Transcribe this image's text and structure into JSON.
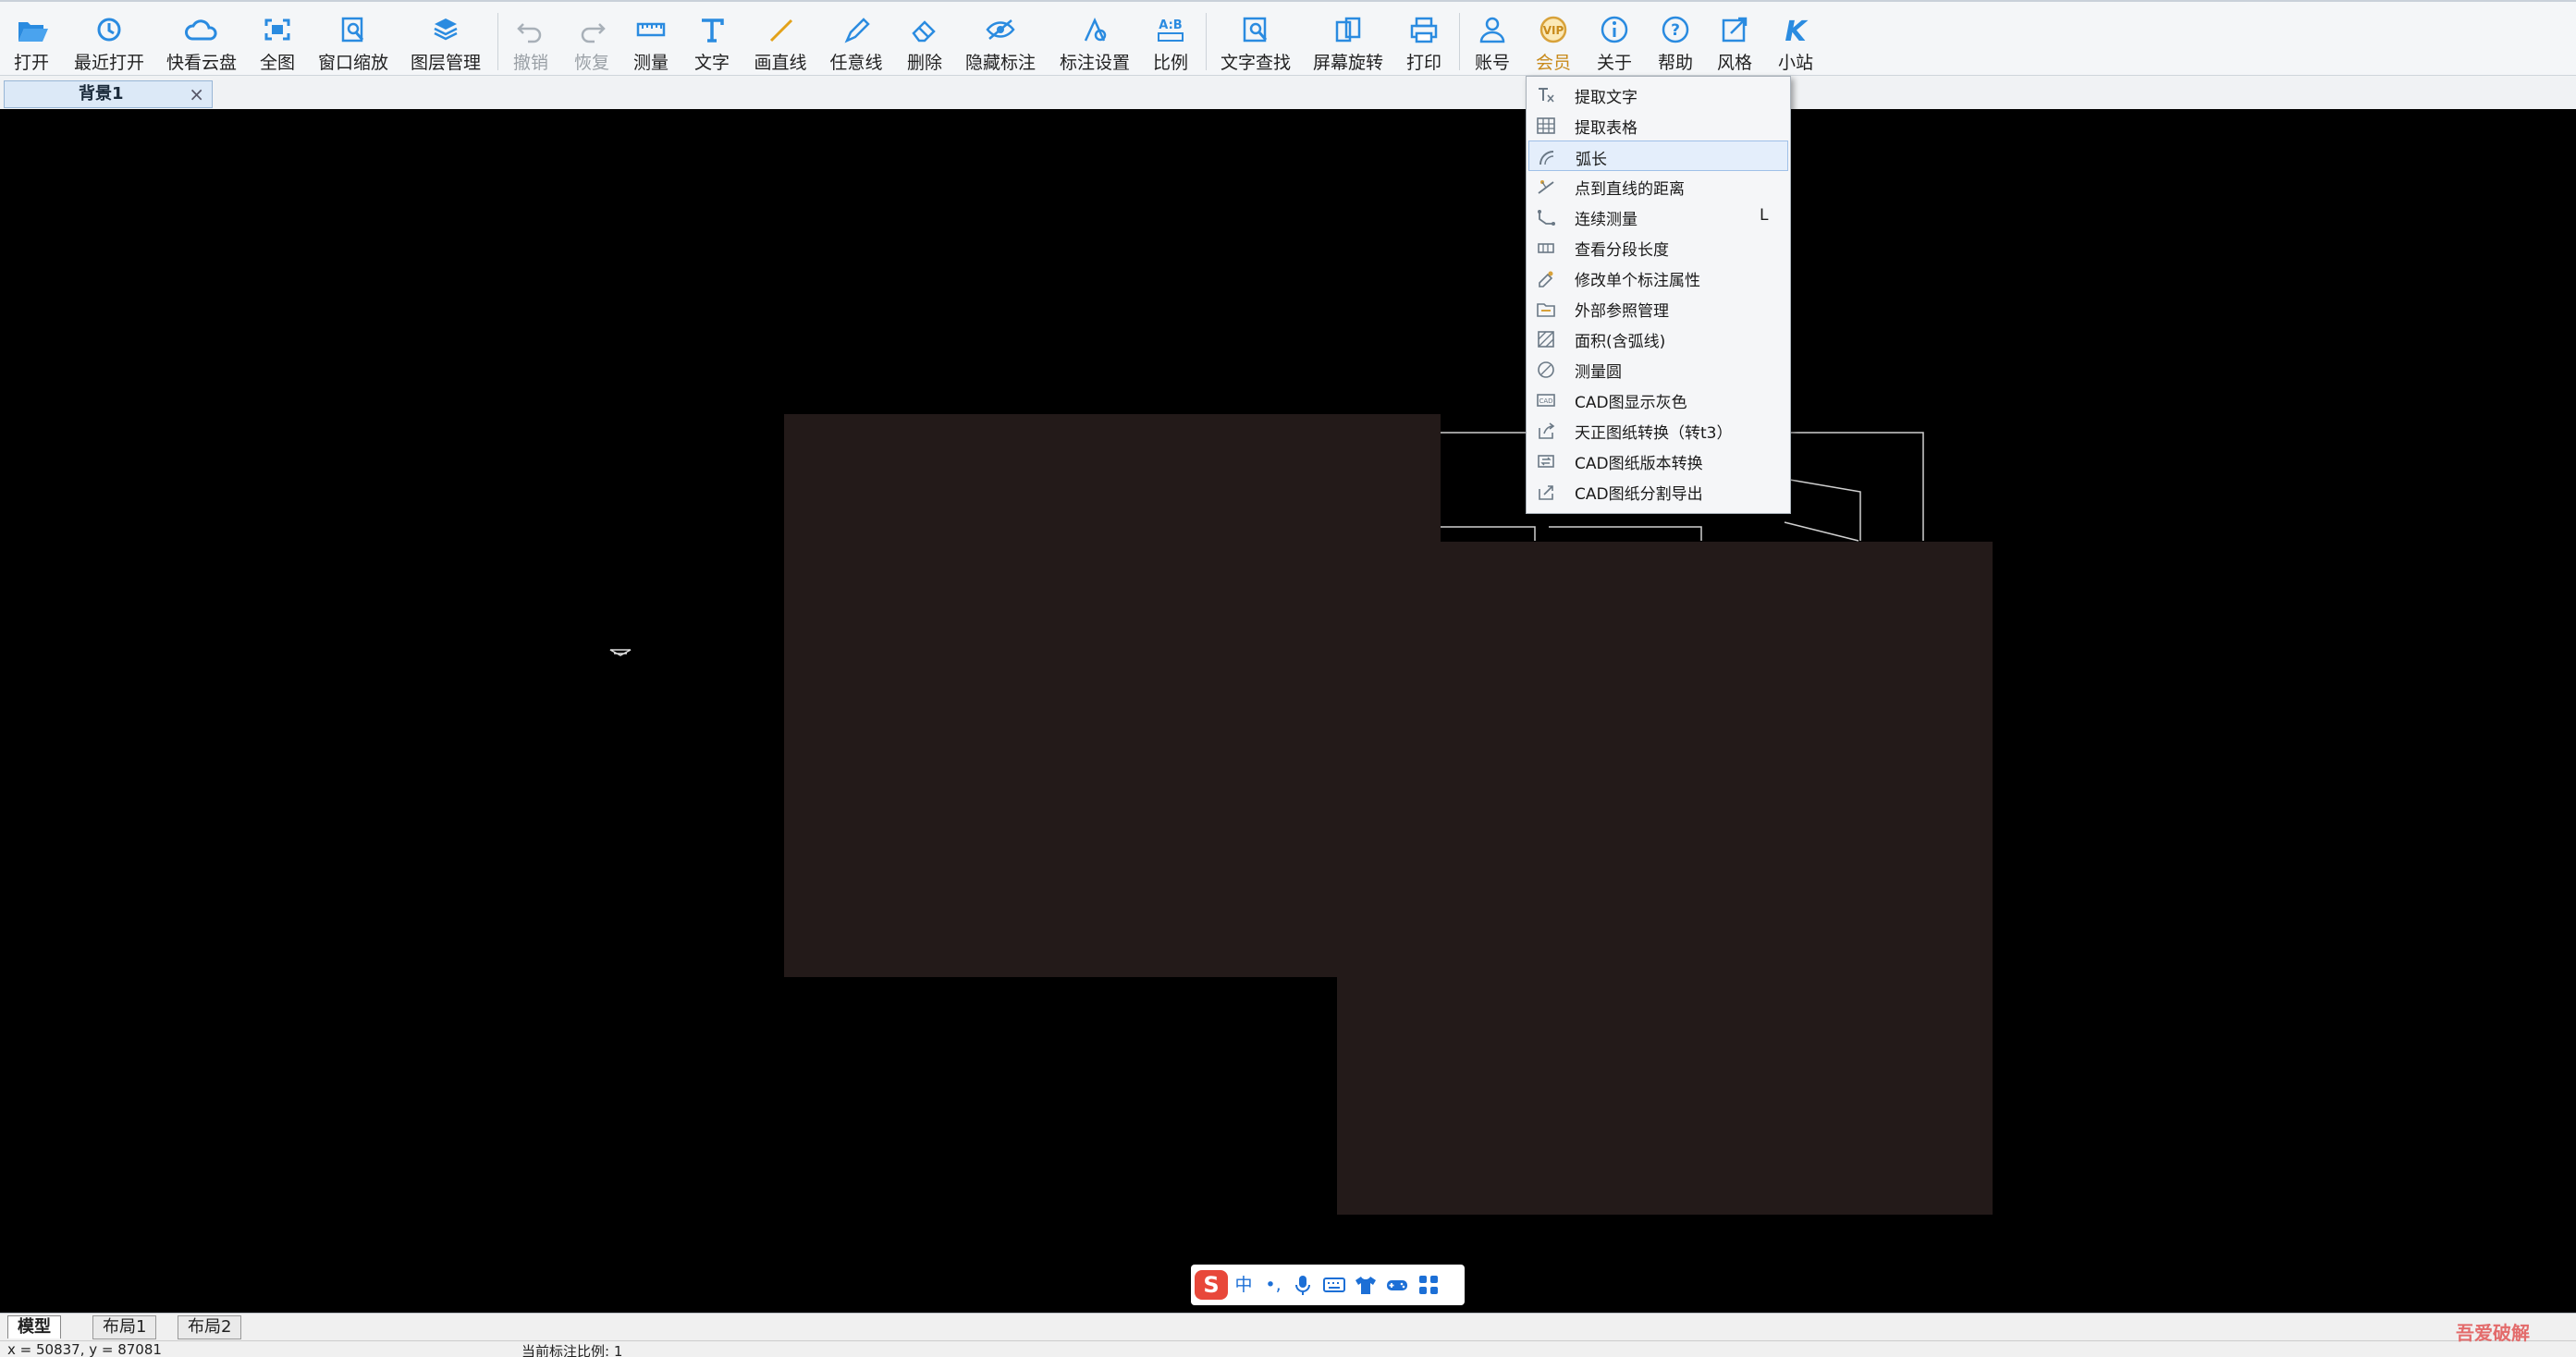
{
  "toolbar": {
    "open": "打开",
    "recent": "最近打开",
    "cloud": "快看云盘",
    "fit": "全图",
    "window_zoom": "窗口缩放",
    "layers": "图层管理",
    "undo": "撤销",
    "redo": "恢复",
    "measure": "测量",
    "text": "文字",
    "draw_line": "画直线",
    "freehand": "任意线",
    "erase": "删除",
    "hide_marks": "隐藏标注",
    "mark_settings": "标注设置",
    "scale": "比例",
    "text_search": "文字查找",
    "rotate": "屏幕旋转",
    "print": "打印",
    "account": "账号",
    "vip": "会员",
    "about": "关于",
    "help": "帮助",
    "style": "风格",
    "mini": "小站"
  },
  "tab": {
    "title": "背景1",
    "close": "×"
  },
  "menu": {
    "items": [
      {
        "label": "提取文字",
        "shortcut": ""
      },
      {
        "label": "提取表格",
        "shortcut": ""
      },
      {
        "label": "弧长",
        "shortcut": ""
      },
      {
        "label": "点到直线的距离",
        "shortcut": ""
      },
      {
        "label": "连续测量",
        "shortcut": "L"
      },
      {
        "label": "查看分段长度",
        "shortcut": ""
      },
      {
        "label": "修改单个标注属性",
        "shortcut": ""
      },
      {
        "label": "外部参照管理",
        "shortcut": ""
      },
      {
        "label": "面积(含弧线)",
        "shortcut": ""
      },
      {
        "label": "测量圆",
        "shortcut": ""
      },
      {
        "label": "CAD图显示灰色",
        "shortcut": ""
      },
      {
        "label": "天正图纸转换（转t3）",
        "shortcut": ""
      },
      {
        "label": "CAD图纸版本转换",
        "shortcut": ""
      },
      {
        "label": "CAD图纸分割导出",
        "shortcut": ""
      }
    ],
    "selected_index": 2
  },
  "ime": {
    "lang": "中",
    "punct": "•,",
    "mic": "mic-icon",
    "keyboard": "keyboard-icon",
    "skin": "shirt-icon",
    "game": "gamepad-icon",
    "apps": "grid-icon"
  },
  "bottom_tabs": [
    "模型",
    "布局1",
    "布局2"
  ],
  "status": {
    "coords": "x = 50837, y = 87081",
    "scale_label": "当前标注比例: 1"
  },
  "watermark": "吾爱破解",
  "colors": {
    "canvas": "#000000",
    "drawing_fill": "#231a19",
    "accent": "#2a8be0",
    "vip": "#d8a23a"
  }
}
